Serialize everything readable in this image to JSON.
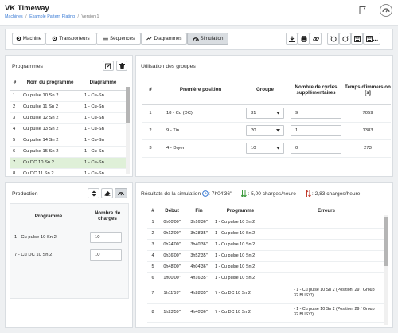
{
  "header": {
    "title": "VK Timeway",
    "breadcrumb": [
      "Machines",
      "Example Pattern Plating",
      "Version 1"
    ],
    "breadcrumb_sep": "/"
  },
  "toolbar": {
    "tabs": [
      {
        "label": "Machine",
        "icon": "gear-icon"
      },
      {
        "label": "Transporteurs",
        "icon": "gear-icon"
      },
      {
        "label": "Séquences",
        "icon": "list-icon"
      },
      {
        "label": "Diagrammes",
        "icon": "chart-icon"
      },
      {
        "label": "Simulation",
        "icon": "dashboard-icon"
      }
    ],
    "active_tab": "Simulation",
    "actions": [
      "download-icon",
      "print-icon",
      "link-icon",
      "undo-icon",
      "redo-icon",
      "save-icon",
      "save-as-icon"
    ]
  },
  "programmes": {
    "title": "Programmes",
    "columns": [
      "#",
      "Nom du programme",
      "Diagramme"
    ],
    "rows": [
      {
        "n": "1",
        "name": "Cu pulse 10 Sn 2",
        "diagram": "1 - Cu-Sn"
      },
      {
        "n": "2",
        "name": "Cu pulse 11 Sn 2",
        "diagram": "1 - Cu-Sn"
      },
      {
        "n": "3",
        "name": "Cu pulse 12 Sn 2",
        "diagram": "1 - Cu-Sn"
      },
      {
        "n": "4",
        "name": "Cu pulse 13 Sn 2",
        "diagram": "1 - Cu-Sn"
      },
      {
        "n": "5",
        "name": "Cu pulse 14 Sn 2",
        "diagram": "1 - Cu-Sn"
      },
      {
        "n": "6",
        "name": "Cu pulse 15 Sn 2",
        "diagram": "1 - Cu-Sn"
      },
      {
        "n": "7",
        "name": "Cu DC 10 Sn 2",
        "diagram": "1 - Cu-Sn"
      },
      {
        "n": "8",
        "name": "Cu DC 11 Sn 2",
        "diagram": "1 - Cu-Sn"
      }
    ],
    "selected_row": 6
  },
  "groupes": {
    "title": "Utilisation des groupes",
    "columns": [
      "#",
      "Première position",
      "Groupe",
      "Nombre de cycles supplémentaires",
      "Temps d'immersion [s]"
    ],
    "rows": [
      {
        "n": "1",
        "pos": "18 - Cu (DC)",
        "groupe": "31",
        "cycles": "9",
        "temps": "7059"
      },
      {
        "n": "2",
        "pos": "9 - Tin",
        "groupe": "20",
        "cycles": "1",
        "temps": "1383"
      },
      {
        "n": "3",
        "pos": "4 - Dryer",
        "groupe": "10",
        "cycles": "0",
        "temps": "273"
      }
    ]
  },
  "production": {
    "title": "Production",
    "columns": [
      "Programme",
      "Nombre de charges"
    ],
    "rows": [
      {
        "prog": "1 - Cu pulse 10 Sn 2",
        "charges": "10"
      },
      {
        "prog": "7 - Cu DC 10 Sn 2",
        "charges": "10"
      }
    ]
  },
  "resultats": {
    "title": "Résultats de la simulation",
    "duration": ": 7h04'36\"",
    "rate1": ": 5,00 charges/heure",
    "rate2": ": 2,83 charges/heure",
    "columns": [
      "#",
      "Début",
      "Fin",
      "Programme",
      "Erreurs"
    ],
    "rows": [
      {
        "n": "1",
        "debut": "0h00'00\"",
        "fin": "3h16'36\"",
        "prog": "1 - Cu pulse 10 Sn 2",
        "err": ""
      },
      {
        "n": "2",
        "debut": "0h12'00\"",
        "fin": "3h28'35\"",
        "prog": "1 - Cu pulse 10 Sn 2",
        "err": ""
      },
      {
        "n": "3",
        "debut": "0h24'00\"",
        "fin": "3h40'36\"",
        "prog": "1 - Cu pulse 10 Sn 2",
        "err": ""
      },
      {
        "n": "4",
        "debut": "0h36'00\"",
        "fin": "3h52'35\"",
        "prog": "1 - Cu pulse 10 Sn 2",
        "err": ""
      },
      {
        "n": "5",
        "debut": "0h48'00\"",
        "fin": "4h04'36\"",
        "prog": "1 - Cu pulse 10 Sn 2",
        "err": ""
      },
      {
        "n": "6",
        "debut": "1h00'00\"",
        "fin": "4h16'35\"",
        "prog": "1 - Cu pulse 10 Sn 2",
        "err": ""
      },
      {
        "n": "7",
        "debut": "1h11'59\"",
        "fin": "4h28'35\"",
        "prog": "7 - Cu DC 10 Sn 2",
        "err": "- 1 - Cu pulse 10 Sn 2 (Position: 29 / Group 32 BUSY!)"
      },
      {
        "n": "8",
        "debut": "1h23'59\"",
        "fin": "4h40'36\"",
        "prog": "7 - Cu DC 10 Sn 2",
        "err": "- 1 - Cu pulse 10 Sn 2 (Position: 29 / Group 32 BUSY!)"
      }
    ]
  },
  "colors": {
    "selected_row": "#dff0d8",
    "accent_blue": "#3a7bd5",
    "accent_green": "#3c9a3c",
    "accent_red": "#c0392b"
  }
}
